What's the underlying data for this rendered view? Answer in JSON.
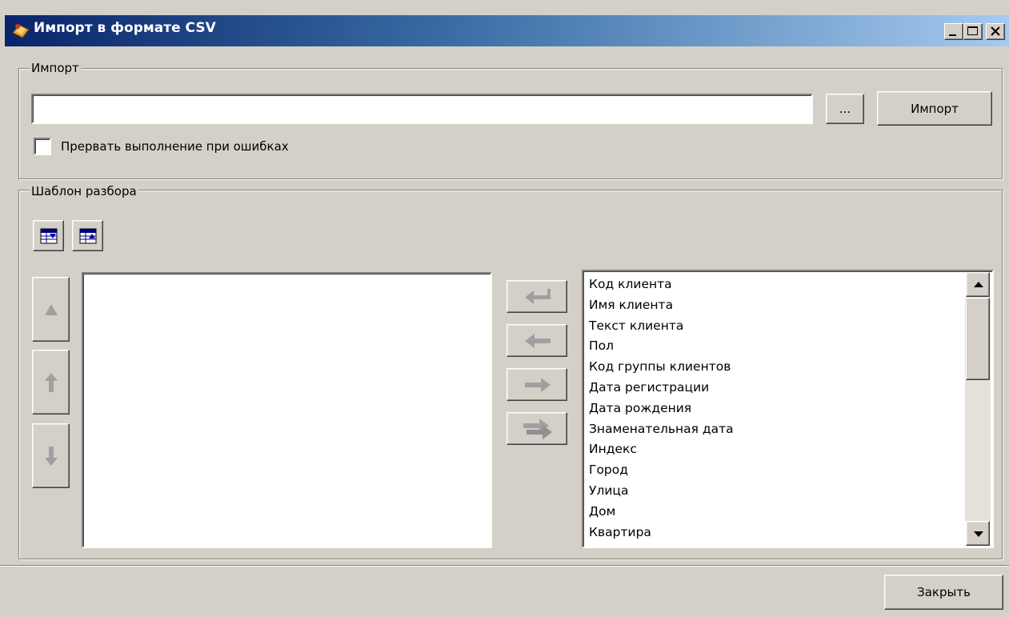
{
  "window": {
    "title": "Импорт в формате CSV",
    "title_icon": "import-app-icon",
    "controls": [
      "minimize-icon",
      "maximize-icon",
      "close-icon"
    ]
  },
  "import_group": {
    "legend": "Импорт",
    "file_path": {
      "value": "",
      "placeholder": ""
    },
    "browse_label": "...",
    "import_label": "Импорт",
    "abort_on_error": {
      "label": "Прервать выполнение при ошибках",
      "checked": false
    }
  },
  "template_group": {
    "legend": "Шаблон разбора",
    "toolbar_icons": [
      "load-template-icon",
      "save-template-icon"
    ],
    "reorder_icons": [
      "move-to-top-icon",
      "move-up-icon",
      "move-down-icon"
    ],
    "transfer_icons": [
      "add-all-icon",
      "add-field-icon",
      "remove-field-icon",
      "remove-all-icon"
    ],
    "selected_fields": [],
    "available_fields": [
      "Код клиента",
      "Имя клиента",
      "Текст клиента",
      "Пол",
      "Код группы клиентов",
      "Дата регистрации",
      "Дата рождения",
      "Знаменательная дата",
      "Индекс",
      "Город",
      "Улица",
      "Дом",
      "Квартира"
    ]
  },
  "footer": {
    "close_label": "Закрыть"
  },
  "colors": {
    "title_start": "#0a246a",
    "title_end": "#a6caf0",
    "face": "#d4d0c8"
  }
}
